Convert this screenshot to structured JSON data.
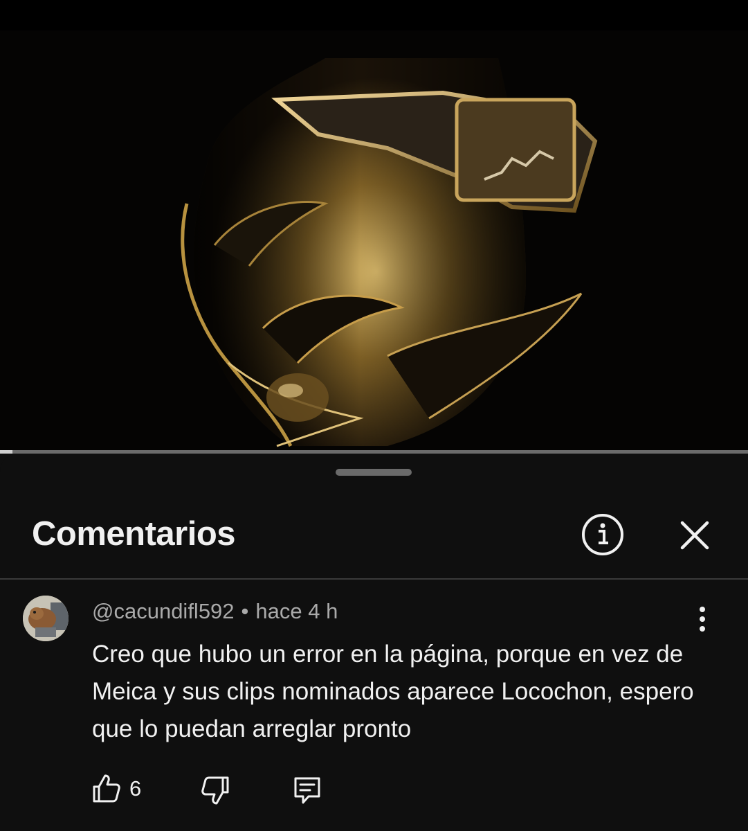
{
  "video": {
    "progress_fraction": 0.017
  },
  "comments_sheet": {
    "title": "Comentarios",
    "info_icon": "info-circle-icon",
    "close_icon": "close-icon"
  },
  "comment": {
    "author": "@cacundifl592",
    "separator": "•",
    "time": "hace 4 h",
    "text": "Creo que hubo un error en la página, porque en vez de Meica y sus clips nominados aparece Locochon, espero que lo puedan arreglar pronto",
    "like_count": "6",
    "more_icon": "more-vert-icon",
    "like_icon": "thumb-up-icon",
    "dislike_icon": "thumb-down-icon",
    "reply_icon": "reply-comment-icon"
  }
}
